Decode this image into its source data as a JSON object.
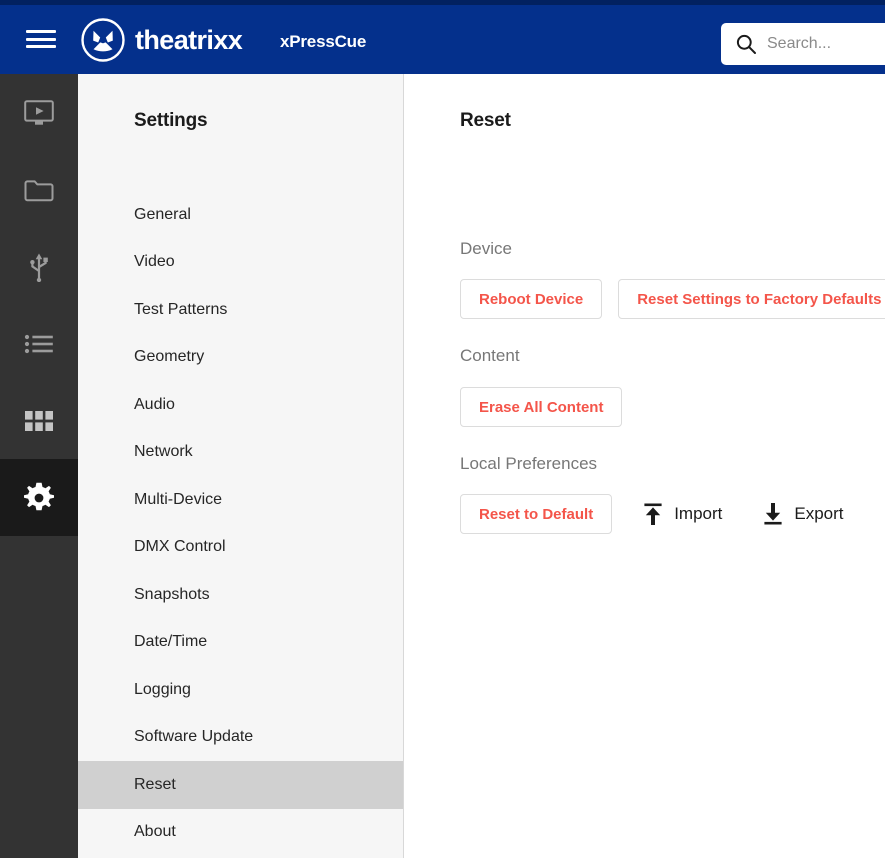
{
  "header": {
    "menu_icon": "hamburger-menu-icon",
    "brand_logo_icon": "theatrixx-logo-icon",
    "brand_name": "theatrixx",
    "product_name": "xPressCue",
    "search": {
      "icon": "search-icon",
      "placeholder": "Search...",
      "value": ""
    },
    "background_color": "#04308C",
    "top_strip_color": "#022160"
  },
  "rail": {
    "background_color": "#333333",
    "active_background_color": "#1a1a1a",
    "items": [
      {
        "icon": "display-output-icon",
        "label": "Display Output",
        "active": false
      },
      {
        "icon": "folder-icon",
        "label": "Media Files",
        "active": false
      },
      {
        "icon": "usb-icon",
        "label": "USB Devices",
        "active": false
      },
      {
        "icon": "playlist-icon",
        "label": "Playlist",
        "active": false
      },
      {
        "icon": "grid-icon",
        "label": "Grid View",
        "active": false
      },
      {
        "icon": "gear-icon",
        "label": "Settings",
        "active": true
      }
    ]
  },
  "settings": {
    "title": "Settings",
    "background_color": "#f6f6f6",
    "active_highlight_color": "#d0d0d0",
    "items": [
      {
        "label": "General",
        "active": false
      },
      {
        "label": "Video",
        "active": false
      },
      {
        "label": "Test Patterns",
        "active": false
      },
      {
        "label": "Geometry",
        "active": false
      },
      {
        "label": "Audio",
        "active": false
      },
      {
        "label": "Network",
        "active": false
      },
      {
        "label": "Multi-Device",
        "active": false
      },
      {
        "label": "DMX Control",
        "active": false
      },
      {
        "label": "Snapshots",
        "active": false
      },
      {
        "label": "Date/Time",
        "active": false
      },
      {
        "label": "Logging",
        "active": false
      },
      {
        "label": "Software Update",
        "active": false
      },
      {
        "label": "Reset",
        "active": true
      },
      {
        "label": "About",
        "active": false
      }
    ]
  },
  "content": {
    "title": "Reset",
    "danger_color": "#f4554a",
    "sections": {
      "device": {
        "label": "Device",
        "reboot_button": "Reboot Device",
        "factory_reset_button": "Reset Settings to Factory Defaults"
      },
      "content": {
        "label": "Content",
        "erase_button": "Erase All Content"
      },
      "local_preferences": {
        "label": "Local Preferences",
        "reset_default_button": "Reset to Default",
        "import_label": "Import",
        "import_icon": "import-upload-icon",
        "export_label": "Export",
        "export_icon": "export-download-icon"
      }
    }
  }
}
